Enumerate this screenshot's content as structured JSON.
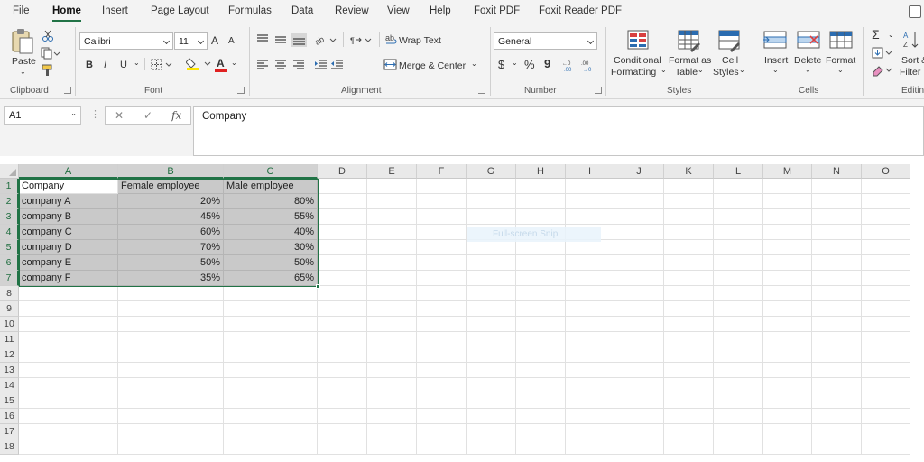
{
  "menu": {
    "file": "File",
    "home": "Home",
    "insert": "Insert",
    "page_layout": "Page Layout",
    "formulas": "Formulas",
    "data": "Data",
    "review": "Review",
    "view": "View",
    "help": "Help",
    "foxit_pdf": "Foxit PDF",
    "foxit_reader_pdf": "Foxit Reader PDF"
  },
  "ribbon": {
    "clipboard": {
      "paste": "Paste",
      "label": "Clipboard"
    },
    "font": {
      "name": "Calibri",
      "size": "11",
      "grow": "A",
      "shrink": "A",
      "bold": "B",
      "italic": "I",
      "underline": "U",
      "font_color": "A",
      "label": "Font"
    },
    "alignment": {
      "wrap_text": "Wrap Text",
      "merge_center": "Merge & Center",
      "label": "Alignment"
    },
    "number": {
      "format": "General",
      "currency": "$",
      "percent": "%",
      "comma": "9",
      "label": "Number"
    },
    "styles": {
      "conditional_1": "Conditional",
      "conditional_2": "Formatting",
      "format_table_1": "Format as",
      "format_table_2": "Table",
      "cell_styles_1": "Cell",
      "cell_styles_2": "Styles",
      "label": "Styles"
    },
    "cells": {
      "insert": "Insert",
      "delete": "Delete",
      "format": "Format",
      "label": "Cells"
    },
    "editing": {
      "autosum": "Σ",
      "sort_1": "Sort &",
      "sort_2": "Filter",
      "label": "Editin"
    }
  },
  "formula_bar": {
    "name_box": "A1",
    "cancel": "✕",
    "enter": "✓",
    "fx": "fx",
    "content": "Company"
  },
  "columns": [
    "A",
    "B",
    "C",
    "D",
    "E",
    "F",
    "G",
    "H",
    "I",
    "J",
    "K",
    "L",
    "M",
    "N",
    "O"
  ],
  "rows": [
    "1",
    "2",
    "3",
    "4",
    "5",
    "6",
    "7",
    "8",
    "9",
    "10",
    "11",
    "12",
    "13",
    "14",
    "15",
    "16",
    "17",
    "18"
  ],
  "table": {
    "header": [
      "Company",
      "Female employee",
      "Male employee"
    ],
    "rows": [
      [
        "company A",
        "20%",
        "80%"
      ],
      [
        "company B",
        "45%",
        "55%"
      ],
      [
        "company C",
        "60%",
        "40%"
      ],
      [
        "company D",
        "70%",
        "30%"
      ],
      [
        "company E",
        "50%",
        "50%"
      ],
      [
        "company F",
        "35%",
        "65%"
      ]
    ]
  },
  "overlay": {
    "snip": "Full-screen Snip"
  },
  "colors": {
    "accent": "#217346",
    "selection_fill": "#c9c9c9",
    "font_color_bar": "#e02020",
    "highlight_bar": "#ffe600",
    "icon_blue": "#2b6cb0",
    "icon_red": "#d94040"
  }
}
